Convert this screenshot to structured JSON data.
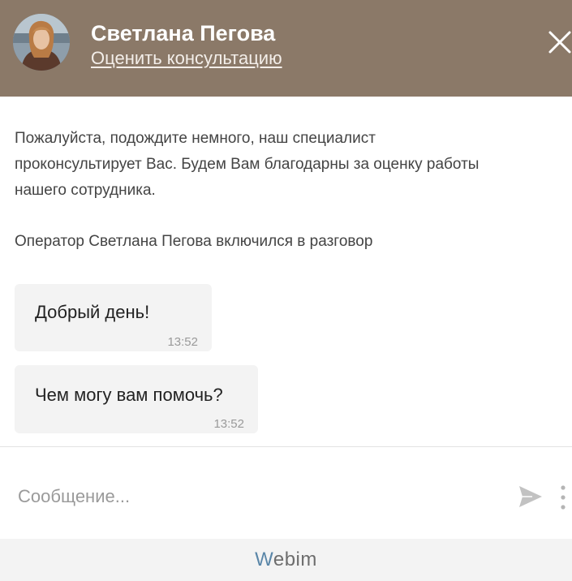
{
  "header": {
    "operator_name": "Светлана Пегова",
    "rate_link": "Оценить консультацию",
    "close_icon": "close-icon",
    "background_color": "#8b7968"
  },
  "messages": {
    "system": [
      "Пожалуйста, подождите немного, наш специалист проконсультирует Вас. Будем Вам благодарны за оценку работы нашего сотрудника.",
      "Оператор Светлана Пегова включился в разговор"
    ],
    "operator": [
      {
        "text": "Добрый день!",
        "time": "13:52"
      },
      {
        "text": "Чем могу вам помочь?",
        "time": "13:52"
      }
    ]
  },
  "input": {
    "placeholder": "Сообщение...",
    "value": "",
    "send_icon": "send-icon",
    "more_icon": "more-vertical-icon"
  },
  "footer": {
    "brand_first": "W",
    "brand_rest": "ebim"
  }
}
